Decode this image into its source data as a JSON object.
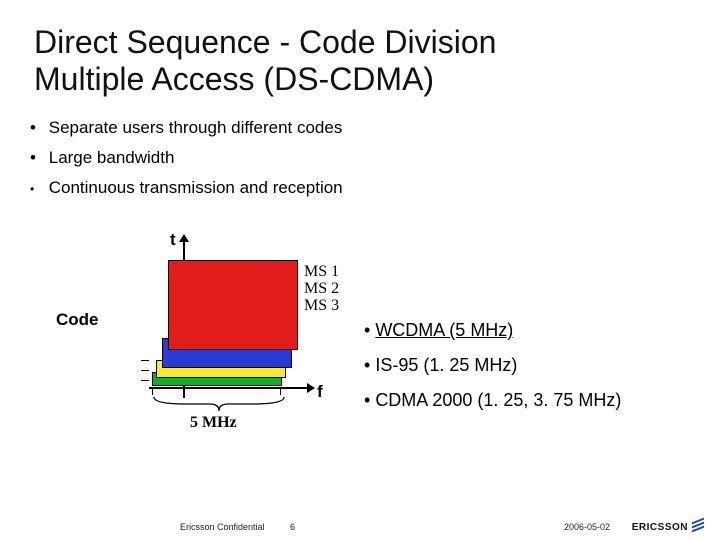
{
  "title_line1": "Direct Sequence - Code Division",
  "title_line2": "Multiple Access (DS-CDMA)",
  "bullets": {
    "b1": "Separate users through different codes",
    "b2": "Large bandwidth",
    "b3": "Continuous transmission and reception"
  },
  "diagram": {
    "axis_t": "t",
    "axis_f": "f",
    "code_label": "Code",
    "ms": {
      "m1": "MS 1",
      "m2": "MS 2",
      "m3": "MS 3"
    },
    "width_label": "5 MHz"
  },
  "right": {
    "r1": "WCDMA (5 MHz)",
    "r2": "IS-95 (1. 25 MHz)",
    "r3": "CDMA 2000 (1. 25, 3. 75 MHz)"
  },
  "footer": {
    "confidential": "Ericsson Confidential",
    "page": "6",
    "date": "2006-05-02",
    "brand": "ERICSSON"
  }
}
